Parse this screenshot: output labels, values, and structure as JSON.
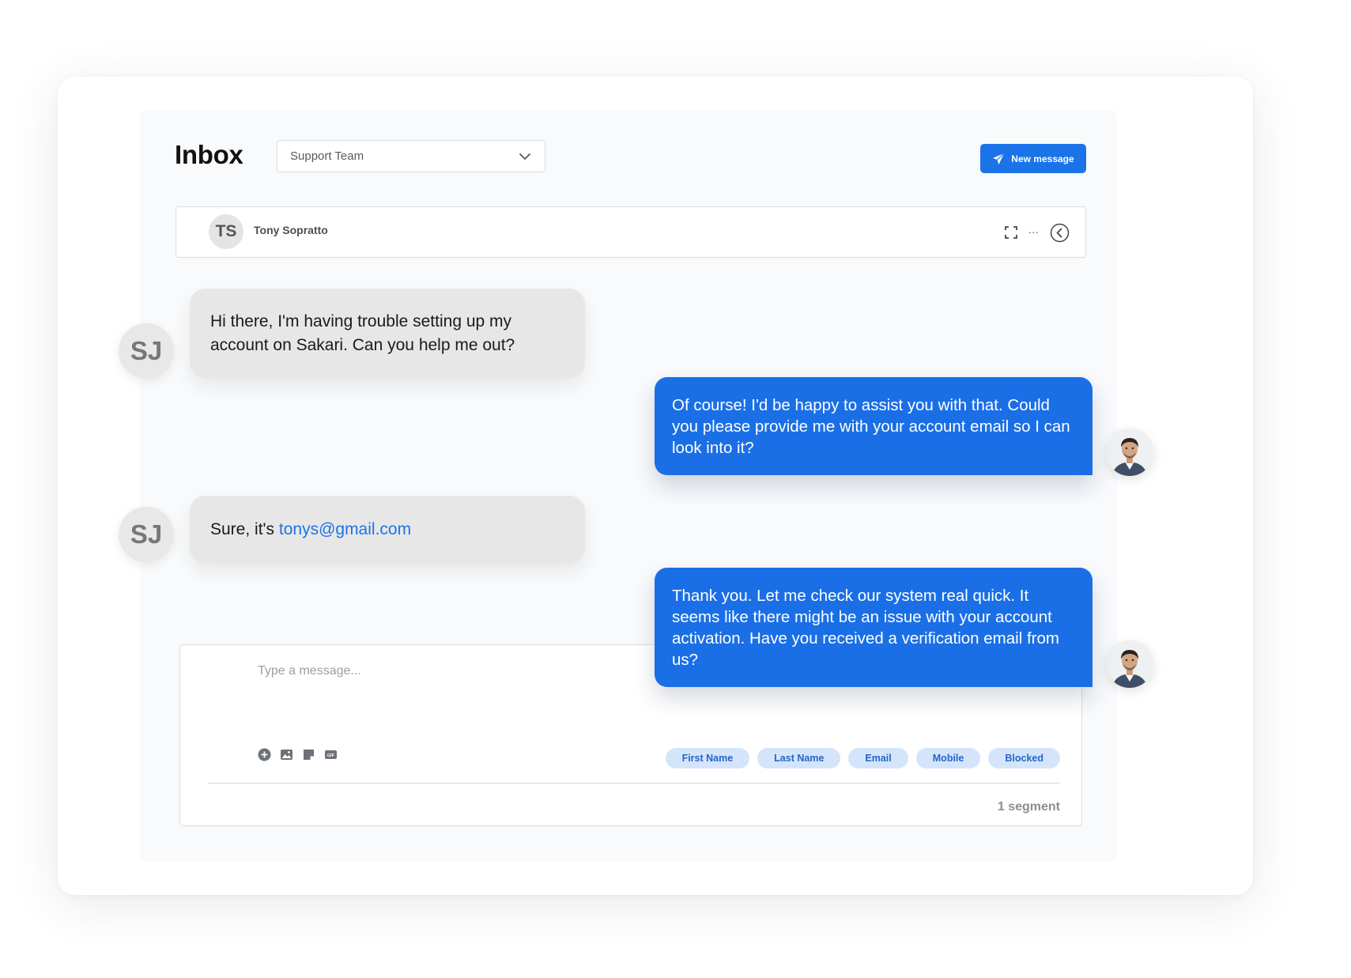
{
  "header": {
    "title": "Inbox",
    "team_select": {
      "value": "Support Team"
    },
    "new_message_label": "New message"
  },
  "conversation": {
    "contact_initials": "TS",
    "contact_name": "Tony Sopratto",
    "more_label": "..."
  },
  "messages": [
    {
      "direction": "incoming",
      "avatar_initials": "SJ",
      "text": "Hi there, I'm having trouble setting up my account on Sakari. Can you help me out?"
    },
    {
      "direction": "outgoing",
      "text": "Of course! I'd be happy to assist you with that. Could you please provide me with your account email so I can look into it?"
    },
    {
      "direction": "incoming",
      "avatar_initials": "SJ",
      "text_prefix": "Sure, it's ",
      "link": "tonys@gmail.com"
    },
    {
      "direction": "outgoing",
      "text": "Thank you. Let me check our system real quick. It seems like there might be an issue with your account activation. Have you received a verification email from us?"
    }
  ],
  "composer": {
    "placeholder": "Type a message...",
    "tools": [
      "add-icon",
      "image-icon",
      "sticker-icon",
      "gif-icon"
    ],
    "chips": [
      "First Name",
      "Last Name",
      "Email",
      "Mobile",
      "Blocked"
    ],
    "segment_count": "1 segment"
  },
  "colors": {
    "accent": "#1a73e8",
    "chip_bg": "#d4e5fb",
    "incoming_bubble": "#e7e7e7"
  }
}
